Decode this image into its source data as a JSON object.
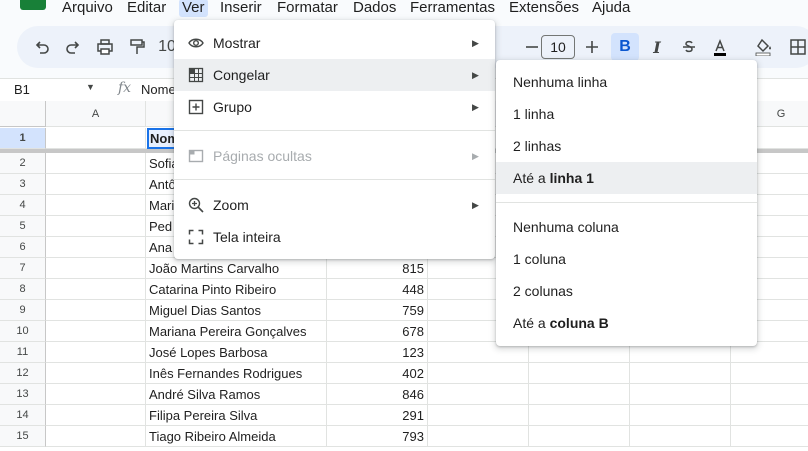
{
  "menubar": {
    "items": [
      "Arquivo",
      "Editar",
      "Ver",
      "Inserir",
      "Formatar",
      "Dados",
      "Ferramentas",
      "Extensões",
      "Ajuda"
    ]
  },
  "toolbar": {
    "font_size": "10",
    "zoom_partial": "10",
    "icons": [
      "undo-icon",
      "redo-icon",
      "print-icon",
      "paint-format-icon",
      "minus-icon",
      "plus-icon",
      "bold-icon",
      "italic-icon",
      "strikethrough-icon",
      "text-color-icon",
      "fill-color-icon",
      "borders-icon"
    ]
  },
  "formula_bar": {
    "cell_ref": "B1",
    "fx": "fx",
    "content": "Nome"
  },
  "grid": {
    "columns": [
      "A",
      "G"
    ],
    "selected_cell_text": "Nom",
    "rows": [
      {
        "n": "1",
        "name": "",
        "value": ""
      },
      {
        "n": "2",
        "name": "Sofia",
        "value": ""
      },
      {
        "n": "3",
        "name": "Antô",
        "value": ""
      },
      {
        "n": "4",
        "name": "Mari",
        "value": ""
      },
      {
        "n": "5",
        "name": "Ped",
        "value": ""
      },
      {
        "n": "6",
        "name": "Ana",
        "value": ""
      },
      {
        "n": "7",
        "name": "João Martins Carvalho",
        "value": "815"
      },
      {
        "n": "8",
        "name": "Catarina Pinto Ribeiro",
        "value": "448"
      },
      {
        "n": "9",
        "name": "Miguel Dias Santos",
        "value": "759"
      },
      {
        "n": "10",
        "name": "Mariana Pereira Gonçalves",
        "value": "678"
      },
      {
        "n": "11",
        "name": "José Lopes Barbosa",
        "value": "123"
      },
      {
        "n": "12",
        "name": "Inês Fernandes Rodrigues",
        "value": "402"
      },
      {
        "n": "13",
        "name": "André Silva Ramos",
        "value": "846"
      },
      {
        "n": "14",
        "name": "Filipa Pereira Silva",
        "value": "291"
      },
      {
        "n": "15",
        "name": "Tiago Ribeiro Almeida",
        "value": "793"
      }
    ]
  },
  "view_menu": {
    "mostrar": "Mostrar",
    "congelar": "Congelar",
    "grupo": "Grupo",
    "paginas_ocultas": "Páginas ocultas",
    "zoom": "Zoom",
    "tela_inteira": "Tela inteira"
  },
  "freeze_submenu": {
    "nenhuma_linha": "Nenhuma linha",
    "uma_linha": "1 linha",
    "duas_linhas": "2 linhas",
    "ate_linha_prefix": "Até a ",
    "ate_linha_bold": "linha 1",
    "nenhuma_coluna": "Nenhuma coluna",
    "uma_coluna": "1 coluna",
    "duas_colunas": "2 colunas",
    "ate_coluna_prefix": "Até a ",
    "ate_coluna_bold": "coluna B"
  }
}
